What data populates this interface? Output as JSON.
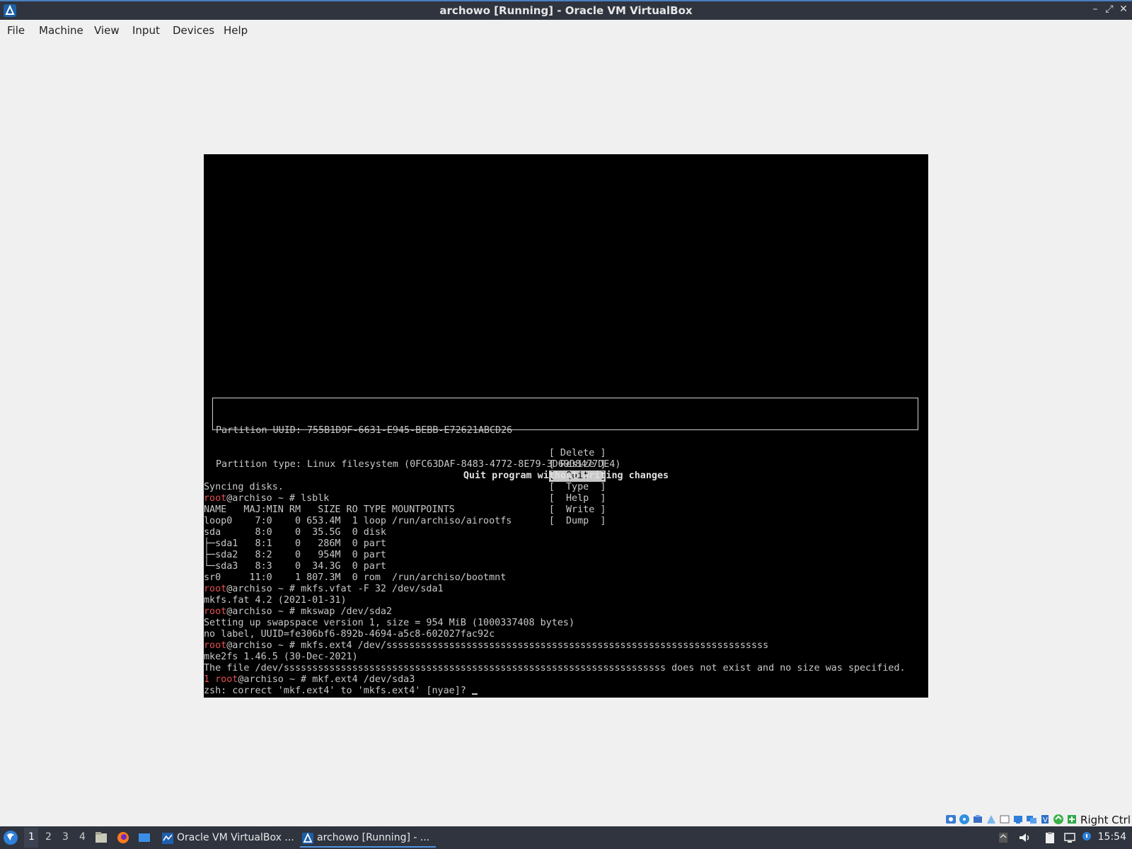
{
  "window": {
    "title": "archowo [Running] - Oracle VM VirtualBox",
    "minimize_glyph": "–",
    "restore_glyph": "⤢",
    "close_glyph": "✕"
  },
  "menu": [
    "File",
    "Machine",
    "View",
    "Input",
    "Devices",
    "Help"
  ],
  "cfdisk": {
    "partition_uuid": "Partition UUID: 755B1D9F-6631-E945-BEBB-E72621ABCD26",
    "partition_type": "Partition type: Linux filesystem (0FC63DAF-8483-4772-8E79-3D69D8477DE4)",
    "buttons": [
      {
        "label": "[ Delete ]",
        "selected": false
      },
      {
        "label": "[ Resize ]",
        "selected": false
      },
      {
        "label": "[  Quit  ]",
        "selected": true
      },
      {
        "label": "[  Type  ]",
        "selected": false
      },
      {
        "label": "[  Help  ]",
        "selected": false
      },
      {
        "label": "[  Write ]",
        "selected": false
      },
      {
        "label": "[  Dump  ]",
        "selected": false
      }
    ],
    "description": "Quit program without writing changes"
  },
  "console": {
    "prompt_user": "root",
    "prompt_rest": "@archiso ~ # ",
    "exit_code": "1",
    "lines": [
      {
        "kind": "out",
        "text": "Syncing disks."
      },
      {
        "kind": "cmd",
        "text": "lsblk"
      },
      {
        "kind": "out",
        "text": "NAME   MAJ:MIN RM   SIZE RO TYPE MOUNTPOINTS"
      },
      {
        "kind": "out",
        "text": "loop0    7:0    0 653.4M  1 loop /run/archiso/airootfs"
      },
      {
        "kind": "out",
        "text": "sda      8:0    0  35.5G  0 disk"
      },
      {
        "kind": "out",
        "text": "├─sda1   8:1    0   286M  0 part"
      },
      {
        "kind": "out",
        "text": "├─sda2   8:2    0   954M  0 part"
      },
      {
        "kind": "out",
        "text": "└─sda3   8:3    0  34.3G  0 part"
      },
      {
        "kind": "out",
        "text": "sr0     11:0    1 807.3M  0 rom  /run/archiso/bootmnt"
      },
      {
        "kind": "cmd",
        "text": "mkfs.vfat -F 32 /dev/sda1"
      },
      {
        "kind": "out",
        "text": "mkfs.fat 4.2 (2021-01-31)"
      },
      {
        "kind": "cmd",
        "text": "mkswap /dev/sda2"
      },
      {
        "kind": "out",
        "text": "Setting up swapspace version 1, size = 954 MiB (1000337408 bytes)"
      },
      {
        "kind": "out",
        "text": "no label, UUID=fe306bf6-892b-4694-a5c8-602027fac92c"
      },
      {
        "kind": "cmd",
        "text": "mkfs.ext4 /dev/sssssssssssssssssssssssssssssssssssssssssssssssssssssssssssssssssss"
      },
      {
        "kind": "out",
        "text": "mke2fs 1.46.5 (30-Dec-2021)"
      },
      {
        "kind": "out",
        "text": "The file /dev/sssssssssssssssssssssssssssssssssssssssssssssssssssssssssssssssssss does not exist and no size was specified."
      },
      {
        "kind": "cmd_err",
        "text": "mkf.ext4 /dev/sda3"
      },
      {
        "kind": "out",
        "text": "zsh: correct 'mkf.ext4' to 'mkfs.ext4' [nyae]? "
      }
    ]
  },
  "statusbar": {
    "host_key": "Right Ctrl"
  },
  "taskbar": {
    "workspaces": [
      "1",
      "2",
      "3",
      "4"
    ],
    "tasks": [
      {
        "label": "Oracle VM VirtualBox ...",
        "icon": "virtualbox-manager-icon"
      },
      {
        "label": "archowo [Running] - ...",
        "icon": "virtualbox-vm-icon"
      }
    ],
    "clock": "15:54"
  }
}
